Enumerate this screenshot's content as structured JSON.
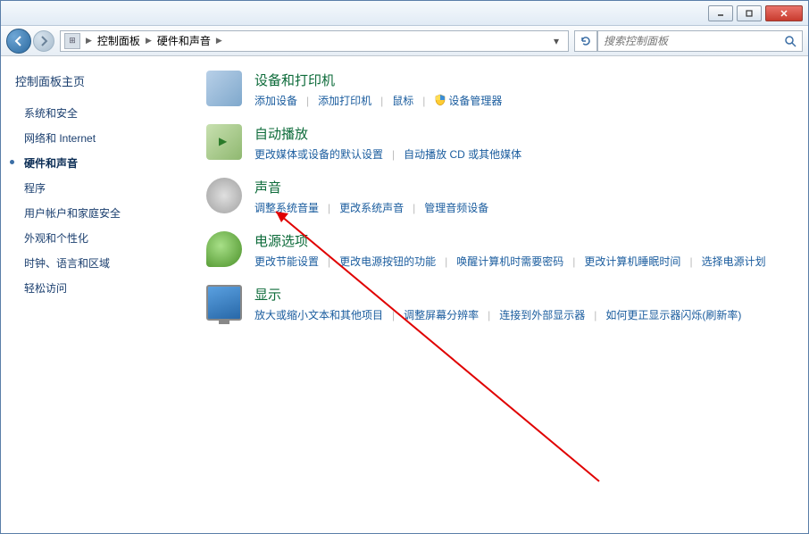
{
  "titlebar": {
    "min_tip": "最小化",
    "max_tip": "最大化",
    "close_tip": "关闭"
  },
  "nav": {
    "crumb_root": "控制面板",
    "crumb_current": "硬件和声音",
    "search_placeholder": "搜索控制面板"
  },
  "sidebar": {
    "title": "控制面板主页",
    "items": [
      {
        "label": "系统和安全",
        "active": false
      },
      {
        "label": "网络和 Internet",
        "active": false
      },
      {
        "label": "硬件和声音",
        "active": true
      },
      {
        "label": "程序",
        "active": false
      },
      {
        "label": "用户帐户和家庭安全",
        "active": false
      },
      {
        "label": "外观和个性化",
        "active": false
      },
      {
        "label": "时钟、语言和区域",
        "active": false
      },
      {
        "label": "轻松访问",
        "active": false
      }
    ]
  },
  "categories": [
    {
      "title": "设备和打印机",
      "icon": "devices",
      "links": [
        {
          "label": "添加设备"
        },
        {
          "label": "添加打印机"
        },
        {
          "label": "鼠标"
        },
        {
          "label": "设备管理器",
          "shield": true
        }
      ]
    },
    {
      "title": "自动播放",
      "icon": "autoplay",
      "links": [
        {
          "label": "更改媒体或设备的默认设置"
        },
        {
          "label": "自动播放 CD 或其他媒体"
        }
      ]
    },
    {
      "title": "声音",
      "icon": "sound",
      "links": [
        {
          "label": "调整系统音量"
        },
        {
          "label": "更改系统声音"
        },
        {
          "label": "管理音频设备"
        }
      ]
    },
    {
      "title": "电源选项",
      "icon": "power",
      "links": [
        {
          "label": "更改节能设置"
        },
        {
          "label": "更改电源按钮的功能"
        },
        {
          "label": "唤醒计算机时需要密码"
        },
        {
          "label": "更改计算机睡眠时间"
        },
        {
          "label": "选择电源计划"
        }
      ]
    },
    {
      "title": "显示",
      "icon": "display",
      "links": [
        {
          "label": "放大或缩小文本和其他项目"
        },
        {
          "label": "调整屏幕分辨率"
        },
        {
          "label": "连接到外部显示器"
        },
        {
          "label": "如何更正显示器闪烁(刷新率)"
        }
      ]
    }
  ]
}
